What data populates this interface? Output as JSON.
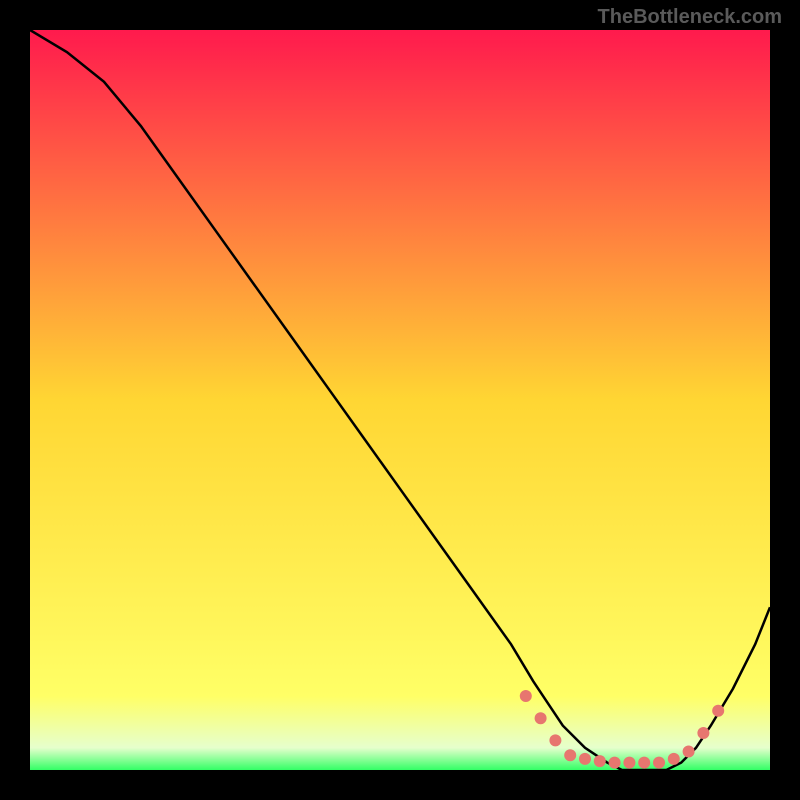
{
  "watermark": "TheBottleneck.com",
  "chart_data": {
    "type": "line",
    "title": "",
    "xlabel": "",
    "ylabel": "",
    "xlim": [
      0,
      100
    ],
    "ylim": [
      0,
      100
    ],
    "background": {
      "type": "vertical-gradient",
      "stops": [
        {
          "offset": 0,
          "color": "#ff1a4d"
        },
        {
          "offset": 50,
          "color": "#ffd633"
        },
        {
          "offset": 90,
          "color": "#ffff66"
        },
        {
          "offset": 97,
          "color": "#e6ffcc"
        },
        {
          "offset": 100,
          "color": "#33ff66"
        }
      ]
    },
    "series": [
      {
        "name": "bottleneck-curve",
        "color": "#000000",
        "x": [
          0,
          5,
          10,
          15,
          20,
          25,
          30,
          35,
          40,
          45,
          50,
          55,
          60,
          65,
          68,
          70,
          72,
          75,
          78,
          80,
          82,
          84,
          86,
          88,
          90,
          92,
          95,
          98,
          100
        ],
        "y": [
          100,
          97,
          93,
          87,
          80,
          73,
          66,
          59,
          52,
          45,
          38,
          31,
          24,
          17,
          12,
          9,
          6,
          3,
          1,
          0,
          0,
          0,
          0,
          1,
          3,
          6,
          11,
          17,
          22
        ]
      }
    ],
    "markers": {
      "name": "highlight-zone",
      "color": "#e7766f",
      "x": [
        67,
        69,
        71,
        73,
        75,
        77,
        79,
        81,
        83,
        85,
        87,
        89,
        91,
        93
      ],
      "y": [
        10,
        7,
        4,
        2,
        1.5,
        1.2,
        1,
        1,
        1,
        1,
        1.5,
        2.5,
        5,
        8
      ]
    }
  }
}
